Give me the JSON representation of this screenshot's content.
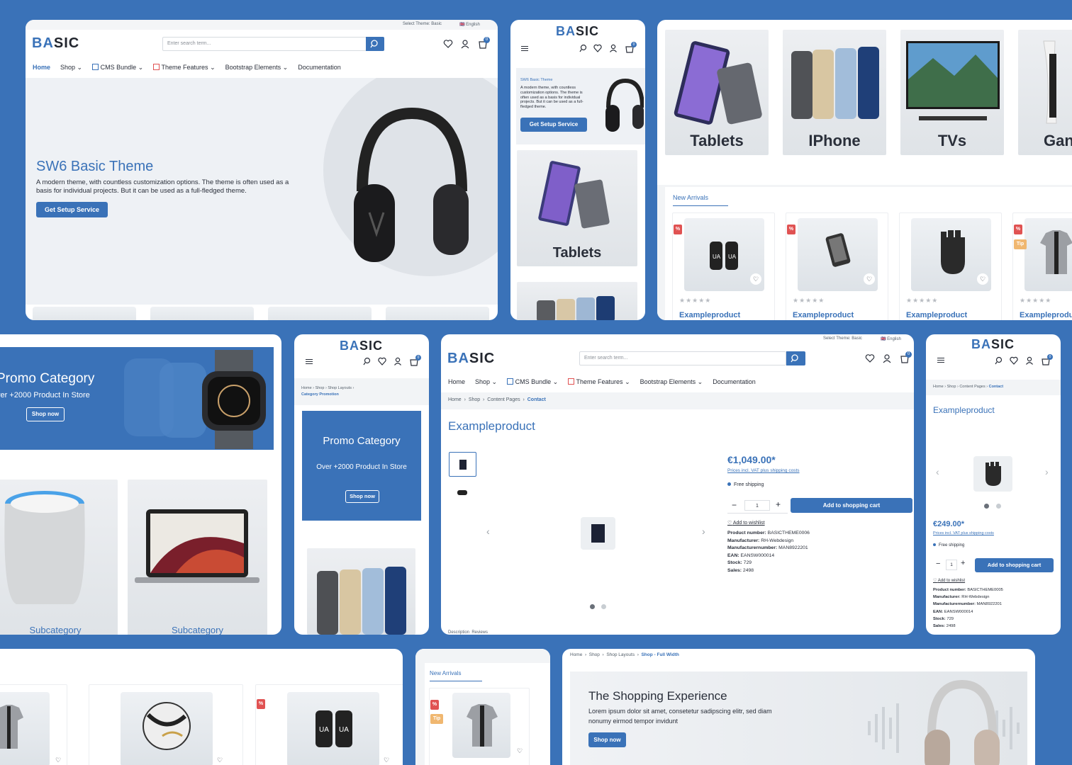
{
  "brand": {
    "prefix": "BA",
    "suffix": "SIC"
  },
  "topbar": {
    "theme_select": "Select Theme: Basic",
    "language": "English"
  },
  "search": {
    "placeholder": "Enter search term..."
  },
  "nav": {
    "home": "Home",
    "shop": "Shop",
    "cms": "CMS Bundle",
    "theme": "Theme Features",
    "bootstrap": "Bootstrap Elements",
    "docs": "Documentation"
  },
  "cart_count": "0",
  "hero": {
    "title": "SW6 Basic Theme",
    "text": "A modern theme, with countless customization options. The theme is often used as a basis for individual projects. But it can be used as a full-fledged theme.",
    "button": "Get Setup Service"
  },
  "mobile_hero": {
    "kicker": "SW6 Basic Theme",
    "text": "A modern theme, with countless customization options. The theme is often used as a basis for individual projects. But it can be used as a full-fledged theme.",
    "button": "Get Setup Service",
    "category": "Tablets"
  },
  "categories": [
    "Tablets",
    "IPhone",
    "TVs",
    "Gan"
  ],
  "new_arrivals": {
    "title": "New Arrivals",
    "product_name": "Exampleproduct",
    "sale_badge": "%",
    "tip_badge": "Tip"
  },
  "promo": {
    "title": "Promo Category",
    "subtitle": "ver +2000 Product In Store",
    "button": "Shop now",
    "subcategory": "Subcategory"
  },
  "promo_mobile": {
    "title": "Promo Category",
    "subtitle": "Over +2000 Product In Store",
    "button": "Shop now",
    "crumbs": [
      "Home",
      "Shop",
      "Shop Layouts",
      "Category Promotion"
    ]
  },
  "pdp": {
    "crumbs": [
      "Home",
      "Shop",
      "Content Pages",
      "Contact"
    ],
    "title": "Exampleproduct",
    "price": "€1,049.00*",
    "price_note": "Prices incl. VAT plus shipping costs",
    "shipping": "Free shipping",
    "qty": "1",
    "add_to_cart": "Add to shopping cart",
    "wishlist": "Add to wishlist",
    "specs": [
      {
        "k": "Product number:",
        "v": "BASICTHEME0006"
      },
      {
        "k": "Manufacturer:",
        "v": "RH-Webdesign"
      },
      {
        "k": "Manufacturernumber:",
        "v": "MAN8922201"
      },
      {
        "k": "EAN:",
        "v": "EANSW000014"
      },
      {
        "k": "Stock:",
        "v": "729"
      },
      {
        "k": "Sales:",
        "v": "2498"
      }
    ],
    "tabs": "Description  Reviews"
  },
  "pdp_mobile": {
    "crumbs": [
      "Home",
      "Shop",
      "Content Pages",
      "Contact"
    ],
    "title": "Exampleproduct",
    "price": "€249.00*",
    "price_note": "Prices incl. VAT plus shipping costs",
    "shipping": "Free shipping",
    "qty": "1",
    "add_to_cart": "Add to shopping cart",
    "wishlist": "Add to wishlist",
    "specs": [
      {
        "k": "Product number:",
        "v": "BASICTHEME0005"
      },
      {
        "k": "Manufacturer:",
        "v": "RH-Webdesign"
      },
      {
        "k": "Manufacturernumber:",
        "v": "MAN8922201"
      },
      {
        "k": "EAN:",
        "v": "EANSW000014"
      },
      {
        "k": "Stock:",
        "v": "729"
      },
      {
        "k": "Sales:",
        "v": "2498"
      }
    ]
  },
  "shopping": {
    "crumbs": [
      "Home",
      "Shop",
      "Shop Layouts",
      "Shop - Full Width"
    ],
    "title": "The Shopping Experience",
    "text": "Lorem ipsum dolor sit amet, consetetur sadipscing elitr, sed diam nonumy eirmod tempor invidunt",
    "button": "Shop now"
  },
  "colors": {
    "accent": "#3a72b8",
    "background": "#3a72b8",
    "sale": "#e05252",
    "tip": "#f0b770"
  }
}
